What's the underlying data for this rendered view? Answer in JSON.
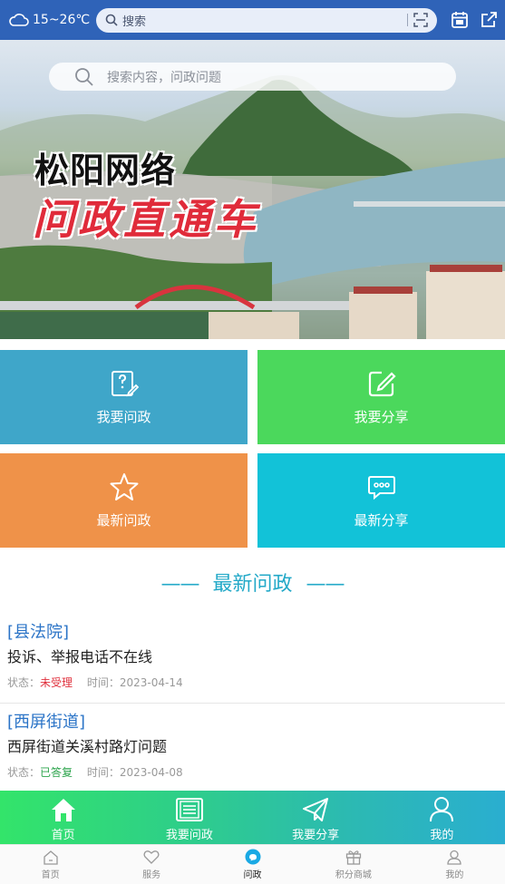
{
  "topbar": {
    "weather_icon": "cloud-icon",
    "temperature": "15~26℃",
    "search_placeholder": "搜索",
    "scan_icon": "scan-icon",
    "calendar_icon": "calendar-icon",
    "share_icon": "external-link-icon"
  },
  "banner": {
    "search_placeholder": "搜索内容，问政问题",
    "title_line1": "松阳网络",
    "title_line2": "问政直通车"
  },
  "tiles": [
    {
      "label": "我要问政",
      "icon": "question-edit-icon",
      "color": "#3fa6c9"
    },
    {
      "label": "我要分享",
      "icon": "edit-square-icon",
      "color": "#4bd85c"
    },
    {
      "label": "最新问政",
      "icon": "star-icon",
      "color": "#ef9249"
    },
    {
      "label": "最新分享",
      "icon": "chat-bubble-icon",
      "color": "#12c2d8"
    }
  ],
  "section": {
    "title": "最新问政",
    "dash": "——"
  },
  "news": [
    {
      "dept": "[县法院]",
      "title": "投诉、举报电话不在线",
      "status_label": "状态：",
      "status": "未受理",
      "time_label": "时间：",
      "time": "2023-04-14"
    },
    {
      "dept": "[西屏街道]",
      "title": "西屏街道关溪村路灯问题",
      "status_label": "状态：",
      "status": "已答复",
      "time_label": "时间：",
      "time": "2023-04-08"
    }
  ],
  "green_nav": [
    {
      "label": "首页",
      "icon": "home-icon"
    },
    {
      "label": "我要问政",
      "icon": "document-icon"
    },
    {
      "label": "我要分享",
      "icon": "paper-plane-icon"
    },
    {
      "label": "我的",
      "icon": "user-icon"
    }
  ],
  "tabbar": [
    {
      "label": "首页",
      "icon": "home-icon"
    },
    {
      "label": "服务",
      "icon": "heart-icon"
    },
    {
      "label": "问政",
      "icon": "chat-badge-icon",
      "active": true
    },
    {
      "label": "积分商城",
      "icon": "gift-icon"
    },
    {
      "label": "我的",
      "icon": "user-icon"
    }
  ],
  "colors": {
    "topbar": "#2f63b8",
    "accent": "#23a9c8",
    "status_pending": "#e0303c",
    "status_answered": "#2aa34a"
  }
}
